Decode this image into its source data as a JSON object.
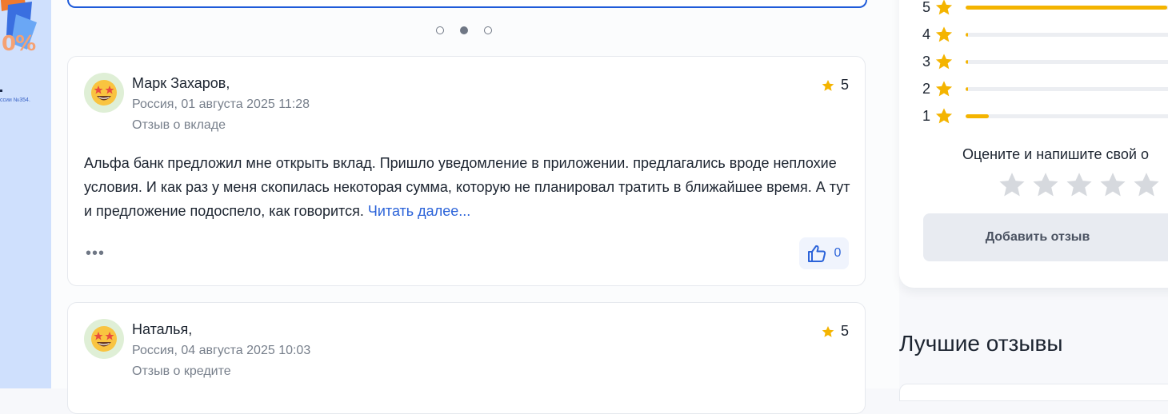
{
  "banner": {
    "percent_text": "0%",
    "fine_print": "ссии №354."
  },
  "carousel": {
    "dots": [
      "slide-1",
      "slide-2",
      "slide-3"
    ],
    "active_index": 1
  },
  "reviews": [
    {
      "author": "Марк Захаров,",
      "meta": "Россия, 01 августа 2025 11:28",
      "topic": "Отзыв о вкладе",
      "rating": "5",
      "text": "Альфа банк предложил мне открыть вклад. Пришло уведомление в приложении. предлагались вроде неплохие условия. И как раз у меня скопилась некоторая сумма, которую не планировал тратить в ближайшее время. А тут и предложение подоспело, как говорится.",
      "read_more": "Читать далее...",
      "more": "•••",
      "likes": "0"
    },
    {
      "author": "Наталья,",
      "meta": "Россия, 04 августа 2025 10:03",
      "topic": "Отзыв о кредите",
      "rating": "5"
    }
  ],
  "rating_distribution": [
    {
      "stars": "5",
      "fraction": 0.97
    },
    {
      "stars": "4",
      "fraction": 0.01
    },
    {
      "stars": "3",
      "fraction": 0.005
    },
    {
      "stars": "2",
      "fraction": 0.005
    },
    {
      "stars": "1",
      "fraction": 0.11
    }
  ],
  "rate_prompt": "Оцените и напишите свой о",
  "add_review_label": "Добавить отзыв",
  "best_reviews_title": "Лучшие отзывы",
  "colors": {
    "accent": "#2b63d9",
    "star": "#f4b400",
    "empty_star": "#d6d9de",
    "banner_bg": "#cfe0fd"
  }
}
